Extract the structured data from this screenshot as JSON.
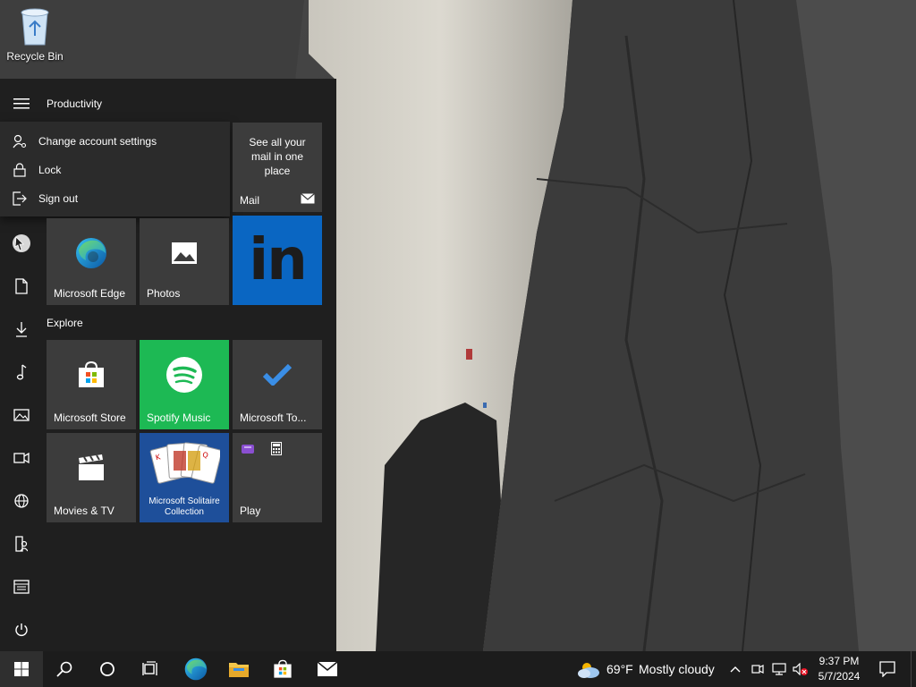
{
  "desktop": {
    "recycle_bin_label": "Recycle Bin"
  },
  "start_menu": {
    "group_productivity": "Productivity",
    "group_explore": "Explore",
    "account_menu": {
      "items": [
        {
          "label": "Change account settings",
          "icon": "account-settings-icon"
        },
        {
          "label": "Lock",
          "icon": "lock-icon"
        },
        {
          "label": "Sign out",
          "icon": "sign-out-icon"
        }
      ]
    },
    "rail_icons": [
      "user-avatar-icon",
      "documents-icon",
      "downloads-icon",
      "music-icon",
      "pictures-icon",
      "videos-icon",
      "network-icon",
      "personal-folder-icon",
      "file-explorer-icon",
      "power-icon"
    ],
    "tiles": {
      "mail": {
        "label": "Mail",
        "caption": "See all your mail in one place"
      },
      "edge": {
        "label": "Microsoft Edge"
      },
      "photos": {
        "label": "Photos"
      },
      "linkedin": {
        "label": "in"
      },
      "store": {
        "label": "Microsoft Store"
      },
      "spotify": {
        "label": "Spotify Music"
      },
      "todo": {
        "label": "Microsoft To..."
      },
      "movies": {
        "label": "Movies & TV"
      },
      "solitaire": {
        "label": "Microsoft Solitaire Collection"
      },
      "play": {
        "label": "Play"
      }
    },
    "colors": {
      "spotify": "#1db954",
      "linkedin": "#0a66c2",
      "solitaire": "#1e4f9a"
    }
  },
  "taskbar": {
    "weather_temp": "69°F",
    "weather_text": "Mostly cloudy",
    "time": "9:37 PM",
    "date": "5/7/2024",
    "pinned": [
      "search-icon",
      "cortana-icon",
      "task-view-icon",
      "edge-icon",
      "file-explorer-icon",
      "store-icon",
      "mail-icon"
    ]
  }
}
